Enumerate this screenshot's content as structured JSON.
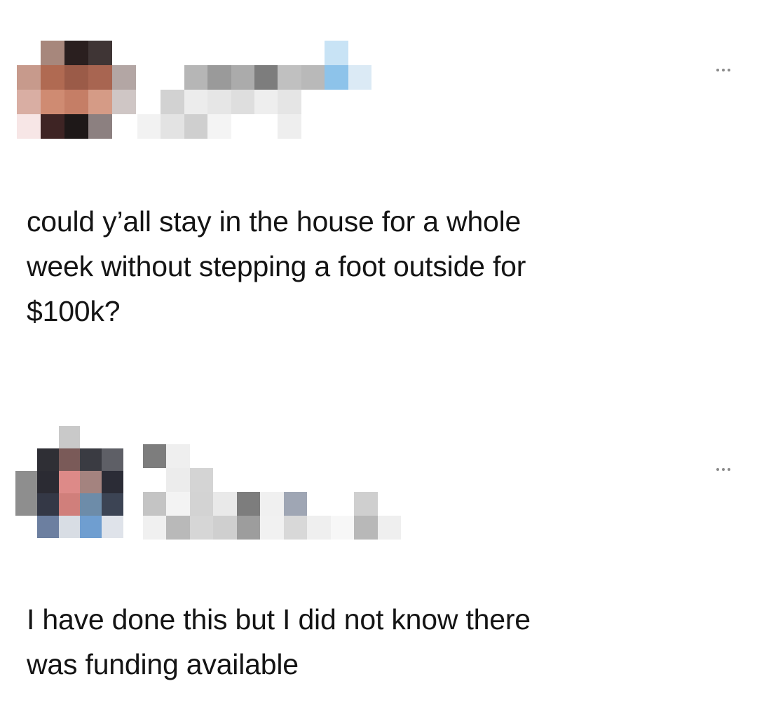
{
  "posts": [
    {
      "id": "original-post",
      "author": {
        "avatar_icon": "pixelated-avatar",
        "name_icon": "pixelated-username"
      },
      "more_icon": "more-options-icon",
      "text": "could y’all stay in the house for a whole\nweek without stepping a foot outside for\n$100k?"
    },
    {
      "id": "reply-post",
      "author": {
        "avatar_icon": "pixelated-avatar",
        "name_icon": "pixelated-username"
      },
      "more_icon": "more-options-icon",
      "text": "I have done this but I did not know there\nwas funding available"
    }
  ],
  "colors": {
    "background": "#ffffff",
    "text": "#141414",
    "icon": "#8a8a8a"
  }
}
